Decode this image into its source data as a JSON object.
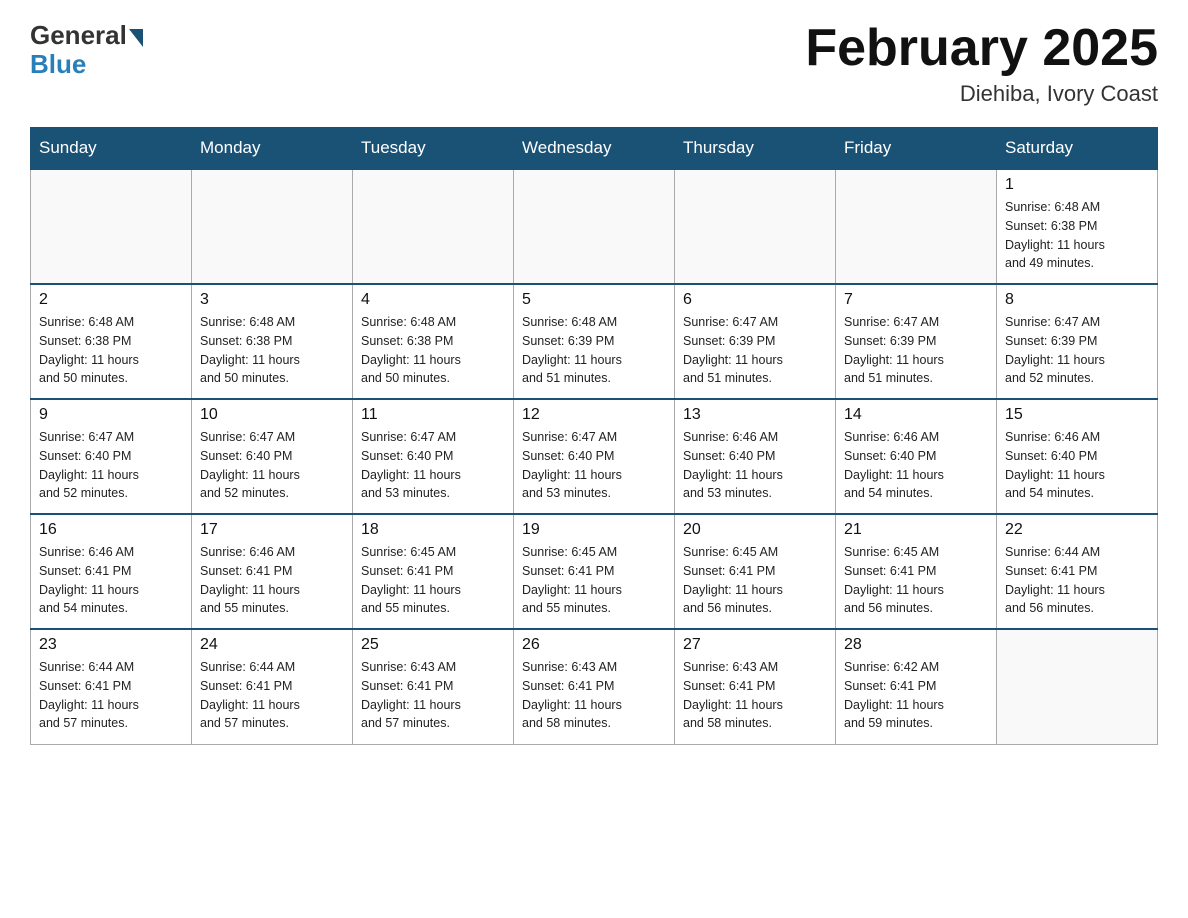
{
  "header": {
    "logo_general": "General",
    "logo_blue": "Blue",
    "month_title": "February 2025",
    "location": "Diehiba, Ivory Coast"
  },
  "days_of_week": [
    "Sunday",
    "Monday",
    "Tuesday",
    "Wednesday",
    "Thursday",
    "Friday",
    "Saturday"
  ],
  "weeks": [
    [
      {
        "day": "",
        "info": ""
      },
      {
        "day": "",
        "info": ""
      },
      {
        "day": "",
        "info": ""
      },
      {
        "day": "",
        "info": ""
      },
      {
        "day": "",
        "info": ""
      },
      {
        "day": "",
        "info": ""
      },
      {
        "day": "1",
        "info": "Sunrise: 6:48 AM\nSunset: 6:38 PM\nDaylight: 11 hours\nand 49 minutes."
      }
    ],
    [
      {
        "day": "2",
        "info": "Sunrise: 6:48 AM\nSunset: 6:38 PM\nDaylight: 11 hours\nand 50 minutes."
      },
      {
        "day": "3",
        "info": "Sunrise: 6:48 AM\nSunset: 6:38 PM\nDaylight: 11 hours\nand 50 minutes."
      },
      {
        "day": "4",
        "info": "Sunrise: 6:48 AM\nSunset: 6:38 PM\nDaylight: 11 hours\nand 50 minutes."
      },
      {
        "day": "5",
        "info": "Sunrise: 6:48 AM\nSunset: 6:39 PM\nDaylight: 11 hours\nand 51 minutes."
      },
      {
        "day": "6",
        "info": "Sunrise: 6:47 AM\nSunset: 6:39 PM\nDaylight: 11 hours\nand 51 minutes."
      },
      {
        "day": "7",
        "info": "Sunrise: 6:47 AM\nSunset: 6:39 PM\nDaylight: 11 hours\nand 51 minutes."
      },
      {
        "day": "8",
        "info": "Sunrise: 6:47 AM\nSunset: 6:39 PM\nDaylight: 11 hours\nand 52 minutes."
      }
    ],
    [
      {
        "day": "9",
        "info": "Sunrise: 6:47 AM\nSunset: 6:40 PM\nDaylight: 11 hours\nand 52 minutes."
      },
      {
        "day": "10",
        "info": "Sunrise: 6:47 AM\nSunset: 6:40 PM\nDaylight: 11 hours\nand 52 minutes."
      },
      {
        "day": "11",
        "info": "Sunrise: 6:47 AM\nSunset: 6:40 PM\nDaylight: 11 hours\nand 53 minutes."
      },
      {
        "day": "12",
        "info": "Sunrise: 6:47 AM\nSunset: 6:40 PM\nDaylight: 11 hours\nand 53 minutes."
      },
      {
        "day": "13",
        "info": "Sunrise: 6:46 AM\nSunset: 6:40 PM\nDaylight: 11 hours\nand 53 minutes."
      },
      {
        "day": "14",
        "info": "Sunrise: 6:46 AM\nSunset: 6:40 PM\nDaylight: 11 hours\nand 54 minutes."
      },
      {
        "day": "15",
        "info": "Sunrise: 6:46 AM\nSunset: 6:40 PM\nDaylight: 11 hours\nand 54 minutes."
      }
    ],
    [
      {
        "day": "16",
        "info": "Sunrise: 6:46 AM\nSunset: 6:41 PM\nDaylight: 11 hours\nand 54 minutes."
      },
      {
        "day": "17",
        "info": "Sunrise: 6:46 AM\nSunset: 6:41 PM\nDaylight: 11 hours\nand 55 minutes."
      },
      {
        "day": "18",
        "info": "Sunrise: 6:45 AM\nSunset: 6:41 PM\nDaylight: 11 hours\nand 55 minutes."
      },
      {
        "day": "19",
        "info": "Sunrise: 6:45 AM\nSunset: 6:41 PM\nDaylight: 11 hours\nand 55 minutes."
      },
      {
        "day": "20",
        "info": "Sunrise: 6:45 AM\nSunset: 6:41 PM\nDaylight: 11 hours\nand 56 minutes."
      },
      {
        "day": "21",
        "info": "Sunrise: 6:45 AM\nSunset: 6:41 PM\nDaylight: 11 hours\nand 56 minutes."
      },
      {
        "day": "22",
        "info": "Sunrise: 6:44 AM\nSunset: 6:41 PM\nDaylight: 11 hours\nand 56 minutes."
      }
    ],
    [
      {
        "day": "23",
        "info": "Sunrise: 6:44 AM\nSunset: 6:41 PM\nDaylight: 11 hours\nand 57 minutes."
      },
      {
        "day": "24",
        "info": "Sunrise: 6:44 AM\nSunset: 6:41 PM\nDaylight: 11 hours\nand 57 minutes."
      },
      {
        "day": "25",
        "info": "Sunrise: 6:43 AM\nSunset: 6:41 PM\nDaylight: 11 hours\nand 57 minutes."
      },
      {
        "day": "26",
        "info": "Sunrise: 6:43 AM\nSunset: 6:41 PM\nDaylight: 11 hours\nand 58 minutes."
      },
      {
        "day": "27",
        "info": "Sunrise: 6:43 AM\nSunset: 6:41 PM\nDaylight: 11 hours\nand 58 minutes."
      },
      {
        "day": "28",
        "info": "Sunrise: 6:42 AM\nSunset: 6:41 PM\nDaylight: 11 hours\nand 59 minutes."
      },
      {
        "day": "",
        "info": ""
      }
    ]
  ]
}
